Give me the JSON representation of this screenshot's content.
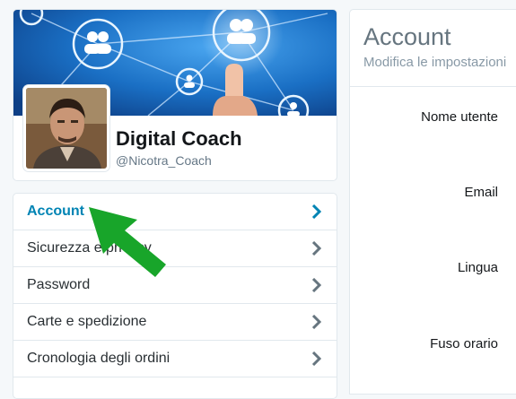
{
  "profile": {
    "name": "Digital Coach",
    "handle": "@Nicotra_Coach"
  },
  "menu": {
    "items": [
      {
        "label": "Account",
        "active": true
      },
      {
        "label": "Sicurezza e privacy",
        "active": false
      },
      {
        "label": "Password",
        "active": false
      },
      {
        "label": "Carte e spedizione",
        "active": false
      },
      {
        "label": "Cronologia degli ordini",
        "active": false
      }
    ]
  },
  "content": {
    "title": "Account",
    "subtitle": "Modifica le impostazioni",
    "fields": [
      "Nome utente",
      "Email",
      "Lingua",
      "Fuso orario"
    ]
  },
  "colors": {
    "accent": "#0084b4",
    "banner": "#1a72c9",
    "annotation_arrow": "#18a52a"
  }
}
